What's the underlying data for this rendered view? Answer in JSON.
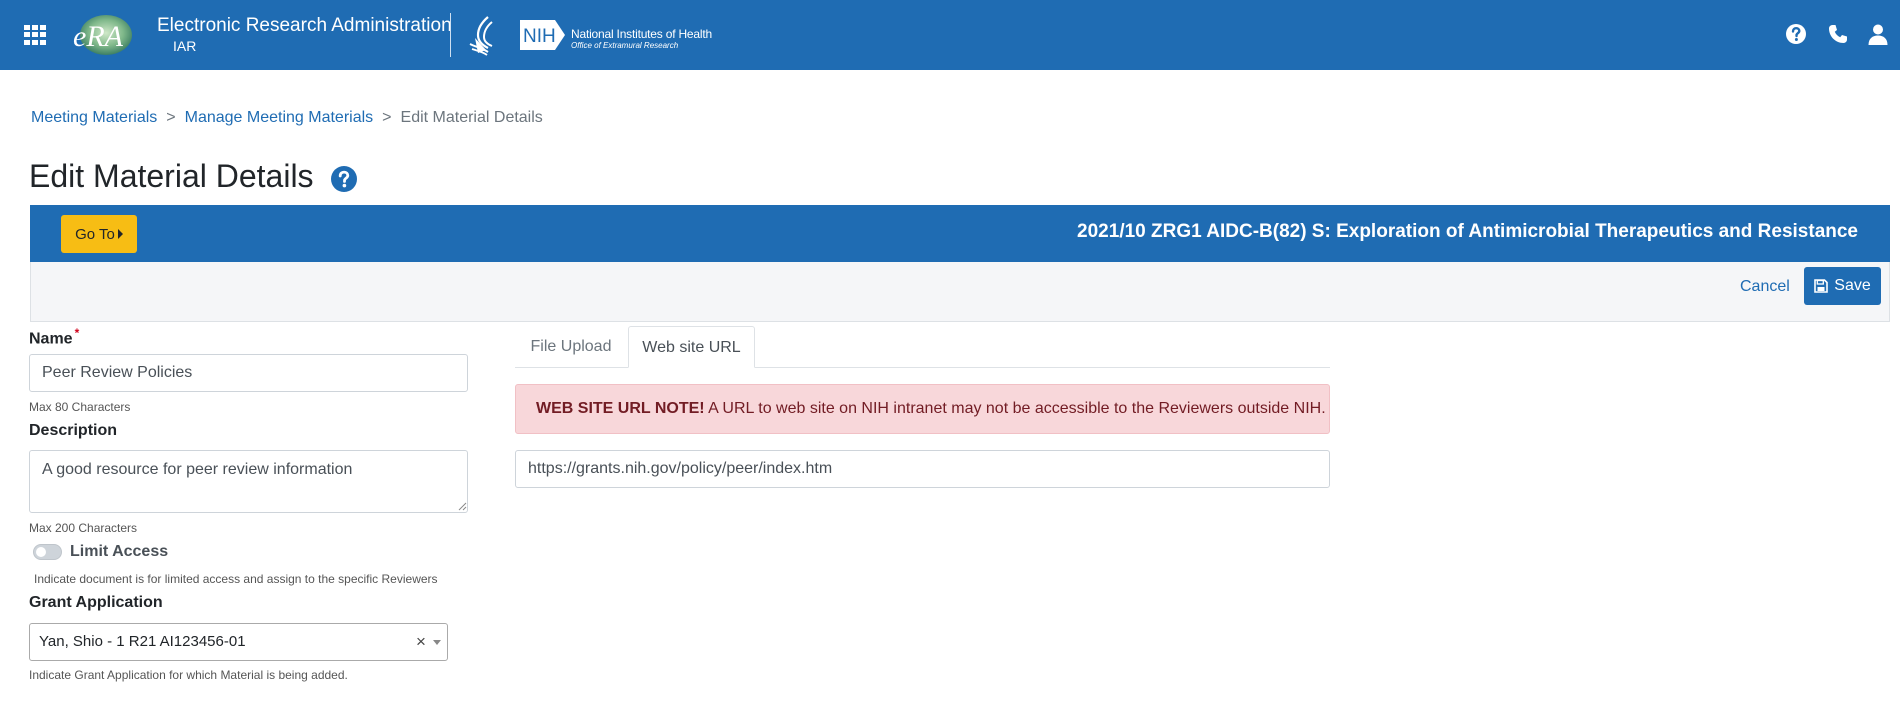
{
  "header": {
    "app_title": "Electronic Research Administration",
    "app_sub": "IAR",
    "era_logo_text": "eRA",
    "nih_logo_text": "NIH",
    "nih_name": "National Institutes of Health",
    "nih_office": "Office of Extramural Research",
    "icons": [
      "apps-grid-icon",
      "help-icon",
      "phone-icon",
      "user-icon"
    ],
    "brand_color": "#1f6cb3"
  },
  "breadcrumb": {
    "items": [
      "Meeting Materials",
      "Manage Meeting Materials"
    ],
    "current": "Edit Material Details",
    "separator": ">"
  },
  "page": {
    "title": "Edit Material Details"
  },
  "band": {
    "goto_label": "Go To",
    "meeting_title": "2021/10 ZRG1 AIDC-B(82) S: Exploration of Antimicrobial Therapeutics and Resistance",
    "goto_color": "#f7bd14"
  },
  "actions": {
    "cancel_label": "Cancel",
    "save_label": "Save"
  },
  "form": {
    "name_label": "Name",
    "name_required_mark": "*",
    "name_value": "Peer Review Policies",
    "name_hint": "Max 80 Characters",
    "description_label": "Description",
    "description_value": "A good resource for peer review information",
    "description_hint": "Max 200 Characters",
    "limit_access_label": "Limit Access",
    "limit_access_on": false,
    "limit_access_hint": "Indicate document is for limited access and assign to the specific Reviewers",
    "grant_label": "Grant Application",
    "grant_value": "Yan, Shio - 1 R21 AI123456-01",
    "grant_clear": "×",
    "grant_hint": "Indicate Grant Application for which Material is being added."
  },
  "tabs": {
    "items": [
      {
        "label": "File Upload",
        "active": false
      },
      {
        "label": "Web site URL",
        "active": true
      }
    ]
  },
  "url_panel": {
    "note_strong": "WEB SITE URL NOTE!",
    "note_text": "A URL to web site on NIH intranet may not be accessible to the Reviewers outside NIH.",
    "url_value": "https://grants.nih.gov/policy/peer/index.htm"
  }
}
